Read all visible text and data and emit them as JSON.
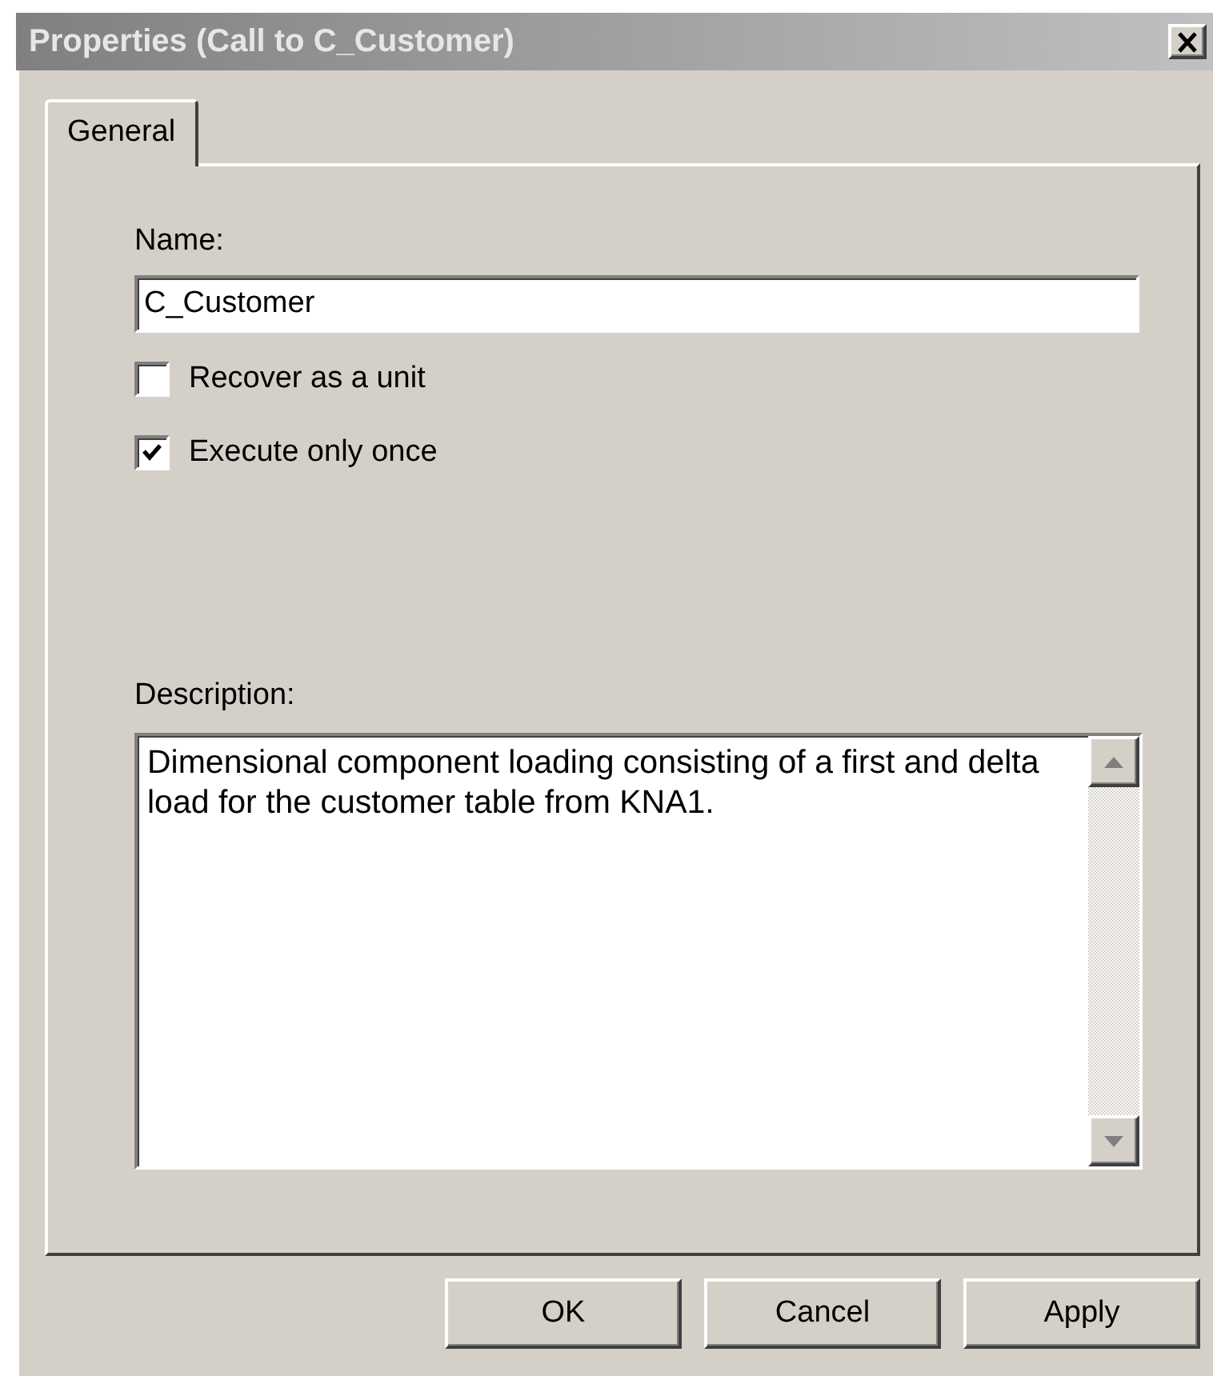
{
  "window": {
    "title": "Properties (Call to C_Customer)"
  },
  "tabs": [
    {
      "label": "General",
      "selected": true
    }
  ],
  "name_field": {
    "label": "Name:",
    "value": "C_Customer"
  },
  "options": [
    {
      "label": "Recover as a unit",
      "checked": false
    },
    {
      "label": "Execute only once",
      "checked": true
    }
  ],
  "description": {
    "label": "Description:",
    "value": "Dimensional component loading consisting of a first and delta load for the customer table from KNA1."
  },
  "buttons": [
    {
      "label": "OK"
    },
    {
      "label": "Cancel"
    },
    {
      "label": "Apply"
    }
  ]
}
